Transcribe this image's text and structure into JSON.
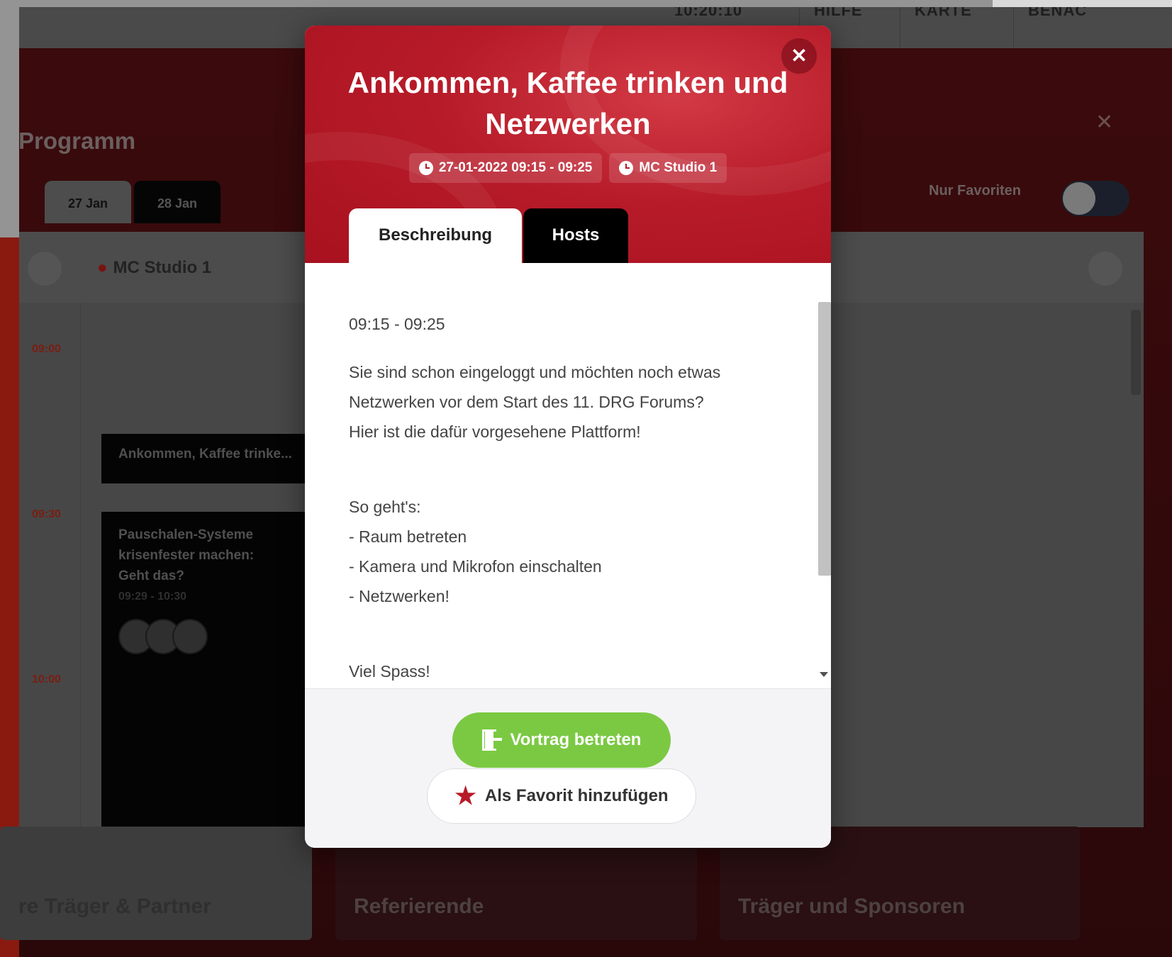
{
  "background": {
    "clock": "10:20:10",
    "nav": [
      "HILFE",
      "KARTE",
      "BENAC"
    ],
    "panel_title": "Programm",
    "days": [
      "27 Jan",
      "28 Jan"
    ],
    "favorites_toggle_label": "Nur Favoriten",
    "room": "MC Studio 1",
    "times": [
      "09:00",
      "09:30",
      "10:00"
    ],
    "events": [
      {
        "title": "Ankommen, Kaffee trinke..."
      },
      {
        "title": "Pauschalen-Systeme krisenfester machen: Geht das?",
        "time": "09:29 - 10:30"
      }
    ],
    "tiles": [
      "re Träger & Partner",
      "Referierende",
      "Träger und Sponsoren"
    ]
  },
  "modal": {
    "title": "Ankommen, Kaffee trinken und Netzwerken",
    "datetime": "27-01-2022 09:15 - 09:25",
    "location": "MC Studio 1",
    "tabs": [
      "Beschreibung",
      "Hosts"
    ],
    "body": {
      "time": "09:15 - 09:25",
      "intro": [
        "Sie sind schon eingeloggt und möchten noch etwas",
        "Netzwerken vor dem Start des 11. DRG Forums?",
        "Hier ist die dafür vorgesehene Plattform!"
      ],
      "steps_heading": "So geht's:",
      "steps": [
        "- Raum betreten",
        "- Kamera und Mikrofon einschalten",
        "- Netzwerken!"
      ],
      "closing": "Viel Spass!"
    },
    "enter_button": "Vortrag betreten",
    "favorite_button": "Als Favorit hinzufügen",
    "close_icon": "close-icon"
  },
  "colors": {
    "accent": "#b71b29",
    "enter_green": "#7bc943"
  }
}
